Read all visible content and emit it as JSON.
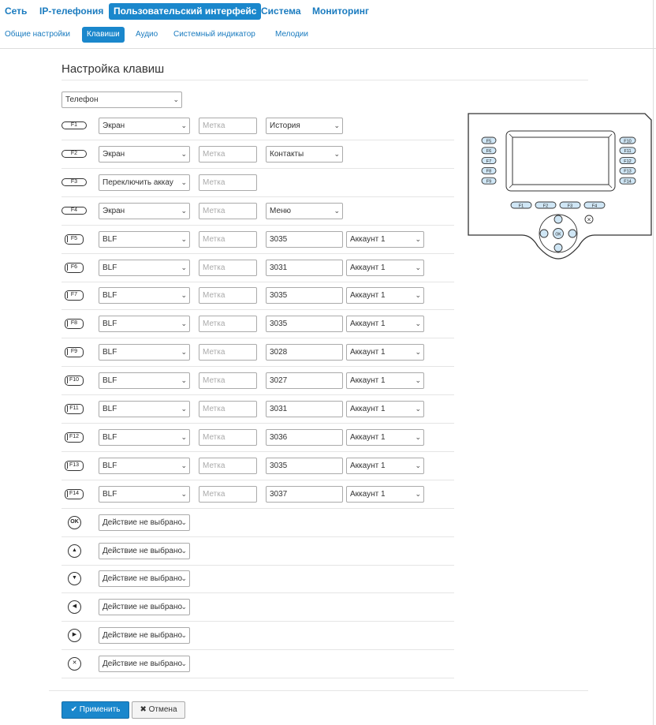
{
  "topnav": {
    "items": [
      "Сеть",
      "IP-телефония",
      "Пользовательский интерфейс",
      "Система",
      "Мониторинг"
    ],
    "active": 2
  },
  "subnav": {
    "items": [
      "Общие настройки",
      "Клавиши",
      "Аудио",
      "Системный индикатор",
      "Мелодии"
    ],
    "active": 1
  },
  "page_title": "Настройка клавиш",
  "device_select": "Телефон",
  "placeholder_label": "Метка",
  "keys": [
    {
      "key": "F1",
      "type": "Экран",
      "label": "",
      "extra": "История",
      "account": null
    },
    {
      "key": "F2",
      "type": "Экран",
      "label": "",
      "extra": "Контакты",
      "account": null
    },
    {
      "key": "F3",
      "type": "Переключить аккау",
      "label": "",
      "extra": null,
      "account": null
    },
    {
      "key": "F4",
      "type": "Экран",
      "label": "",
      "extra": "Меню",
      "account": null
    },
    {
      "key": "F5",
      "type": "BLF",
      "label": "",
      "value": "3035",
      "account": "Аккаунт 1"
    },
    {
      "key": "F6",
      "type": "BLF",
      "label": "",
      "value": "3031",
      "account": "Аккаунт 1"
    },
    {
      "key": "F7",
      "type": "BLF",
      "label": "",
      "value": "3035",
      "account": "Аккаунт 1"
    },
    {
      "key": "F8",
      "type": "BLF",
      "label": "",
      "value": "3035",
      "account": "Аккаунт 1"
    },
    {
      "key": "F9",
      "type": "BLF",
      "label": "",
      "value": "3028",
      "account": "Аккаунт 1"
    },
    {
      "key": "F10",
      "type": "BLF",
      "label": "",
      "value": "3027",
      "account": "Аккаунт 1"
    },
    {
      "key": "F11",
      "type": "BLF",
      "label": "",
      "value": "3031",
      "account": "Аккаунт 1"
    },
    {
      "key": "F12",
      "type": "BLF",
      "label": "",
      "value": "3036",
      "account": "Аккаунт 1"
    },
    {
      "key": "F13",
      "type": "BLF",
      "label": "",
      "value": "3035",
      "account": "Аккаунт 1"
    },
    {
      "key": "F14",
      "type": "BLF",
      "label": "",
      "value": "3037",
      "account": "Аккаунт 1"
    }
  ],
  "nav_keys": [
    {
      "key": "OK",
      "icon": "ok-icon",
      "action": "Действие не выбрано"
    },
    {
      "key": "up",
      "icon": "up-icon",
      "action": "Действие не выбрано"
    },
    {
      "key": "down",
      "icon": "down-icon",
      "action": "Действие не выбрано"
    },
    {
      "key": "left",
      "icon": "left-icon",
      "action": "Действие не выбрано"
    },
    {
      "key": "right",
      "icon": "right-icon",
      "action": "Действие не выбрано"
    },
    {
      "key": "cancel",
      "icon": "close-icon",
      "action": "Действие не выбрано"
    }
  ],
  "phone_diagram": {
    "left_keys": [
      "F5",
      "F6",
      "F7",
      "F8",
      "F9"
    ],
    "right_keys": [
      "F10",
      "F11",
      "F12",
      "F13",
      "F14"
    ],
    "bottom_keys": [
      "F1",
      "F2",
      "F3",
      "F4"
    ],
    "ok": "OK"
  },
  "buttons": {
    "apply": "Применить",
    "cancel": "Отмена"
  },
  "colors": {
    "accent": "#1a87cc",
    "link": "#1a7bbf"
  }
}
